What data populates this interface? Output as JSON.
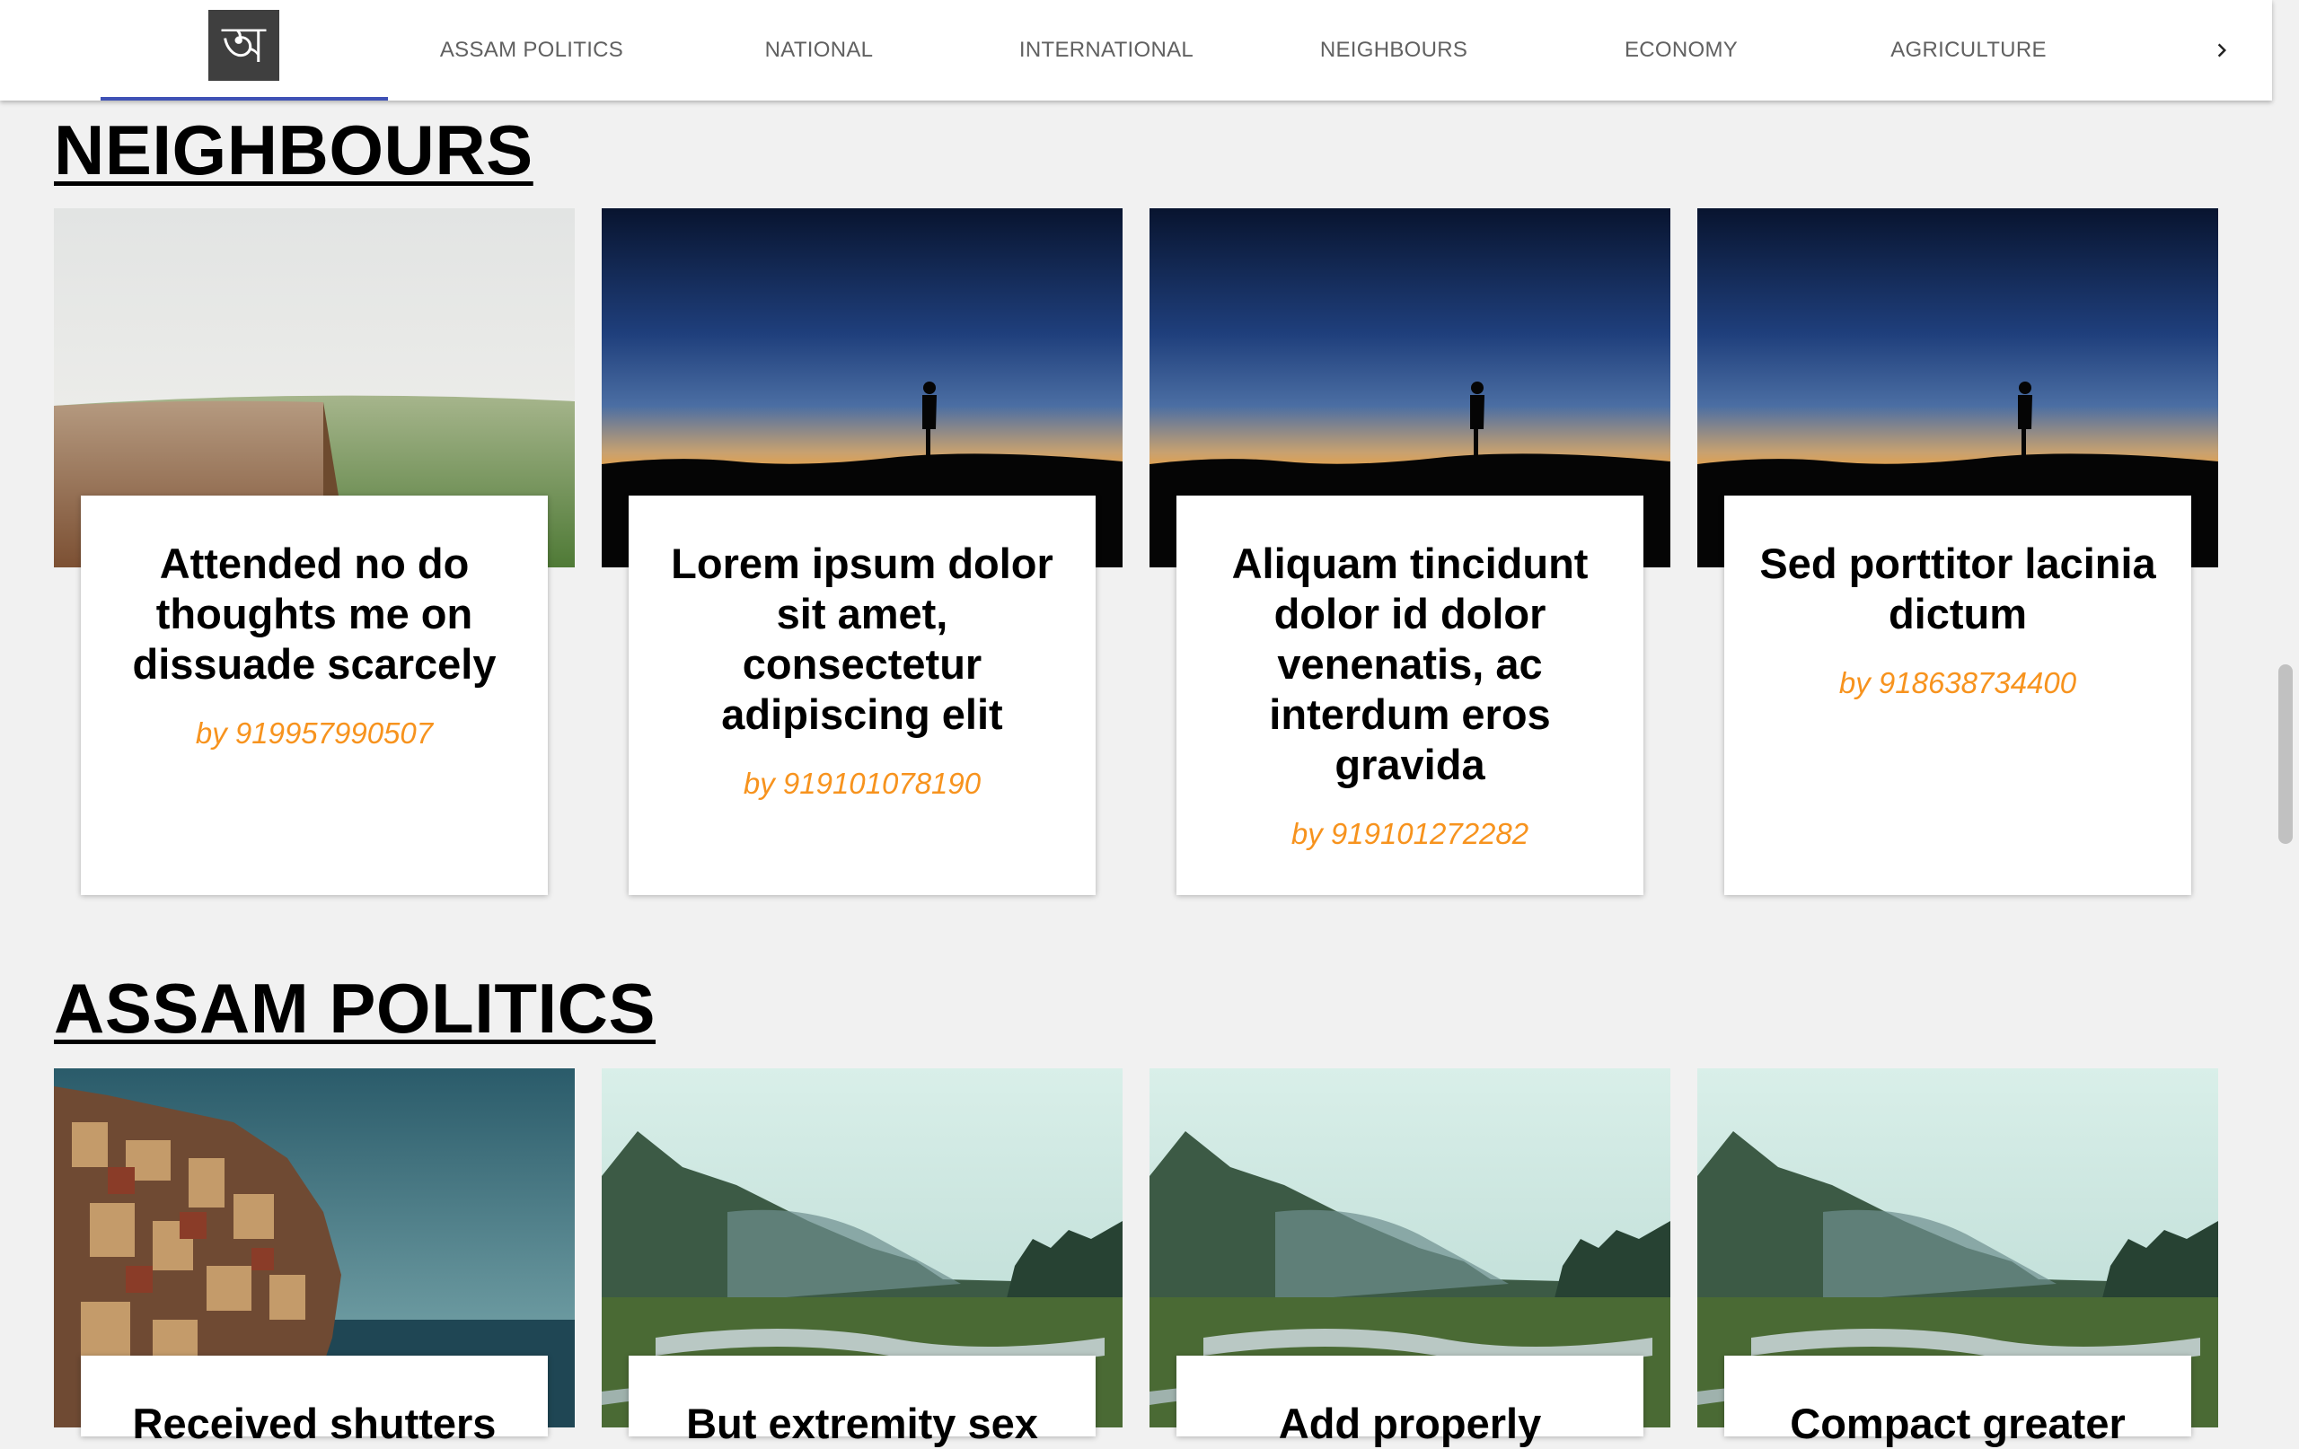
{
  "nav": {
    "logo_glyph": "অ",
    "items": [
      {
        "label": "ASSAM POLITICS"
      },
      {
        "label": "NATIONAL"
      },
      {
        "label": "INTERNATIONAL"
      },
      {
        "label": "NEIGHBOURS"
      },
      {
        "label": "ECONOMY"
      },
      {
        "label": "AGRICULTURE"
      }
    ],
    "next_icon": "chevron-right-icon",
    "active_color": "#3f51b5"
  },
  "sections": [
    {
      "title": "NEIGHBOURS",
      "cards": [
        {
          "title": "Attended no do thoughts me on dissuade scarcely",
          "author": "by 919957990507",
          "image": "field"
        },
        {
          "title": "Lorem ipsum dolor sit amet, consectetur adipiscing elit",
          "author": "by 919101078190",
          "image": "sunset"
        },
        {
          "title": "Aliquam tincidunt dolor id dolor venenatis, ac interdum eros gravida",
          "author": "by 919101272282",
          "image": "sunset"
        },
        {
          "title": "Sed porttitor lacinia dictum",
          "author": "by 918638734400",
          "image": "sunset"
        }
      ]
    },
    {
      "title": "ASSAM POLITICS",
      "cards": [
        {
          "title": "Received shutters",
          "author": "",
          "image": "town"
        },
        {
          "title": "But extremity sex",
          "author": "",
          "image": "valley"
        },
        {
          "title": "Add properly",
          "author": "",
          "image": "valley"
        },
        {
          "title": "Compact greater",
          "author": "",
          "image": "valley"
        }
      ]
    }
  ],
  "colors": {
    "author": "#f7931e",
    "background": "#f1f1f1"
  }
}
